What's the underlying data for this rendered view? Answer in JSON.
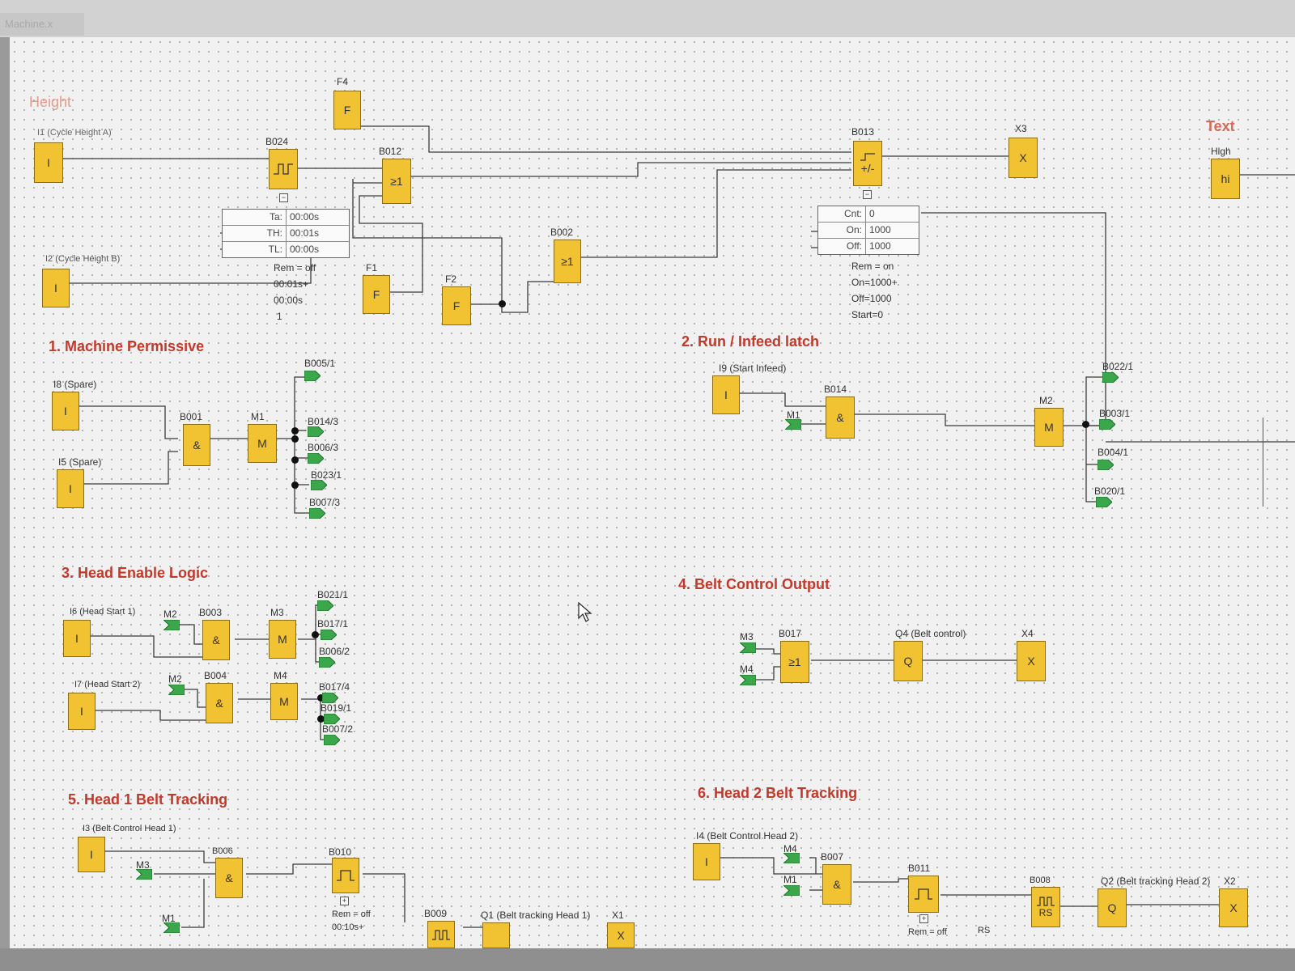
{
  "tab": {
    "title": "Machine.x"
  },
  "colors": {
    "block": "#f1c232",
    "flag": "#3aa84a",
    "heading": "#c0392b",
    "wire": "#333333"
  },
  "top": {
    "height_heading": "Height",
    "text_heading": "Text",
    "i1": {
      "label": "I1 (Cycle Height A)",
      "symbol": "I"
    },
    "i2": {
      "label": "I2 (Cycle Height B)",
      "symbol": "I"
    },
    "f4": {
      "label": "F4",
      "symbol": "F"
    },
    "f1": {
      "label": "F1",
      "symbol": "F"
    },
    "f2": {
      "label": "F2",
      "symbol": "F"
    },
    "b024": {
      "label": "B024"
    },
    "b012": {
      "label": "B012",
      "symbol": "≥1"
    },
    "b002": {
      "label": "B002",
      "symbol": "≥1"
    },
    "b013": {
      "label": "B013",
      "symbol": "+/-"
    },
    "x3": {
      "label": "X3",
      "symbol": "X"
    },
    "hi": {
      "label": "High",
      "symbol": "hi"
    },
    "timer_table": [
      {
        "k": "Ta:",
        "v": "00:00s"
      },
      {
        "k": "TH:",
        "v": "00:01s"
      },
      {
        "k": "TL:",
        "v": "00:00s"
      }
    ],
    "timer_notes": [
      "Rem = off",
      "00:01s+",
      "00:00s",
      "1"
    ],
    "counter_table": [
      {
        "k": "Cnt:",
        "v": "0"
      },
      {
        "k": "On:",
        "v": "1000"
      },
      {
        "k": "Off:",
        "v": "1000"
      }
    ],
    "counter_notes": [
      "Rem = on",
      "On=1000+",
      "Off=1000",
      "Start=0"
    ]
  },
  "s1": {
    "title": "1. Machine Permissive",
    "i8": {
      "label": "I8 (Spare)",
      "symbol": "I"
    },
    "i5": {
      "label": "I5 (Spare)",
      "symbol": "I"
    },
    "b001": {
      "label": "B001",
      "symbol": "&"
    },
    "m1": {
      "label": "M1",
      "symbol": "M"
    },
    "flags": [
      "B005/1",
      "B014/3",
      "B006/3",
      "B023/1",
      "B007/3"
    ]
  },
  "s2": {
    "title": "2. Run / Infeed latch",
    "i9": {
      "label": "I9 (Start Infeed)",
      "symbol": "I"
    },
    "m1flag": "M1",
    "b014": {
      "label": "B014",
      "symbol": "&"
    },
    "m2": {
      "label": "M2",
      "symbol": "M"
    },
    "flags": [
      "B022/1",
      "B003/1",
      "B004/1",
      "B020/1"
    ]
  },
  "s3": {
    "title": "3. Head Enable Logic",
    "i6": {
      "label": "I6 (Head Start 1)",
      "symbol": "I"
    },
    "i7": {
      "label": "I7 (Head Start 2)",
      "symbol": "I"
    },
    "m2a": "M2",
    "m2b": "M2",
    "b003": {
      "label": "B003",
      "symbol": "&"
    },
    "b004": {
      "label": "B004",
      "symbol": "&"
    },
    "m3": {
      "label": "M3",
      "symbol": "M"
    },
    "m4": {
      "label": "M4",
      "symbol": "M"
    },
    "flags_a": [
      "B021/1",
      "B017/1",
      "B006/2"
    ],
    "flags_b": [
      "B017/4",
      "B019/1",
      "B007/2"
    ]
  },
  "s4": {
    "title": "4. Belt Control Output",
    "m3flag": "M3",
    "m4flag": "M4",
    "b017": {
      "label": "B017",
      "symbol": "≥1"
    },
    "q4": {
      "label": "Q4 (Belt control)",
      "symbol": "Q"
    },
    "x4": {
      "label": "X4",
      "symbol": "X"
    }
  },
  "s5": {
    "title": "5. Head 1 Belt Tracking",
    "i3": {
      "label": "I3 (Belt Control Head 1)",
      "symbol": "I"
    },
    "m3flag": "M3",
    "m1flag": "M1",
    "b006": {
      "label": "B006",
      "symbol": "&"
    },
    "b010": {
      "label": "B010"
    },
    "b010_note": "Rem = off",
    "b010_note2": "00:10s+",
    "b009": {
      "label": "B009"
    },
    "q1": {
      "label": "Q1 (Belt tracking Head 1)"
    },
    "x1": {
      "label": "X1",
      "symbol": "X"
    }
  },
  "s6": {
    "title": "6. Head 2 Belt Tracking",
    "i4": {
      "label": "I4 (Belt Control Head 2)",
      "symbol": "I"
    },
    "m4flag": "M4",
    "m1flag": "M1",
    "b007": {
      "label": "B007",
      "symbol": "&"
    },
    "b011": {
      "label": "B011"
    },
    "b011_note": "Rem = off",
    "b008": {
      "label": "B008",
      "symbol": "RS"
    },
    "rs_note": "RS",
    "q2": {
      "label": "Q2 (Belt tracking Head 2)",
      "symbol": "Q"
    },
    "x2": {
      "label": "X2",
      "symbol": "X"
    }
  }
}
